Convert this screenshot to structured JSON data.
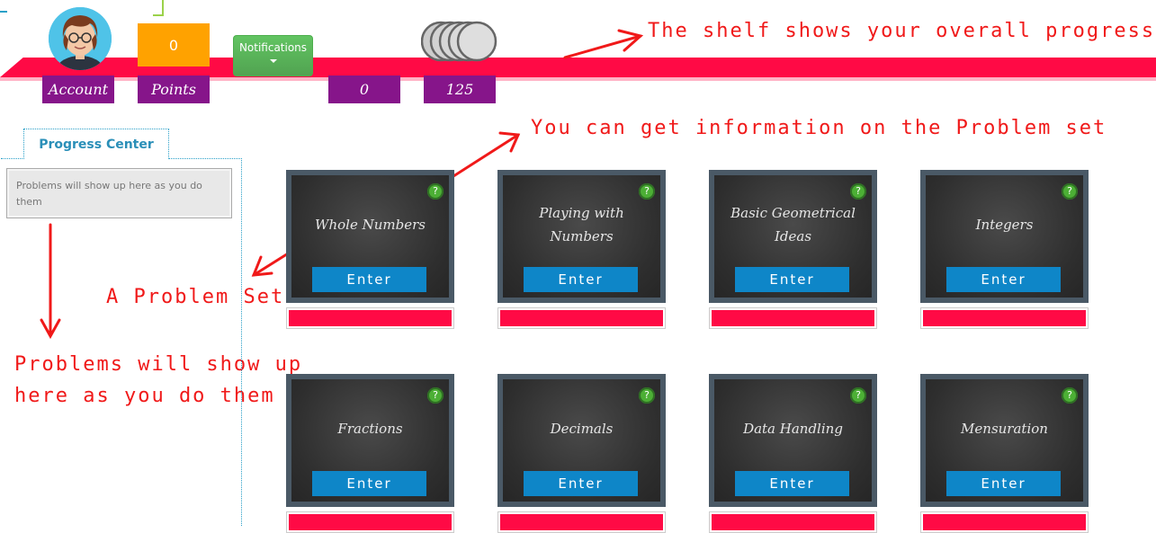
{
  "header": {
    "account_label": "Account",
    "points_label": "Points",
    "points_value": "0",
    "notifications_label": "Notifications",
    "shelf_count": "0",
    "coins_value": "125"
  },
  "annotations": {
    "shelf": "The shelf shows your overall progress",
    "info": "You can get information on the Problem set",
    "problem_set": "A Problem Set",
    "problems_line1": "Problems will show up",
    "problems_line2": "here as you do them"
  },
  "progress_center": {
    "tab_label": "Progress Center",
    "message": "Problems will show up here as you do them"
  },
  "problem_sets": [
    {
      "title": "Whole Numbers",
      "enter_label": "Enter",
      "info_icon": "?",
      "progress": 0
    },
    {
      "title": "Playing with Numbers",
      "enter_label": "Enter",
      "info_icon": "?",
      "progress": 0
    },
    {
      "title": "Basic Geometrical Ideas",
      "enter_label": "Enter",
      "info_icon": "?",
      "progress": 0
    },
    {
      "title": "Integers",
      "enter_label": "Enter",
      "info_icon": "?",
      "progress": 0
    },
    {
      "title": "Fractions",
      "enter_label": "Enter",
      "info_icon": "?",
      "progress": 0
    },
    {
      "title": "Decimals",
      "enter_label": "Enter",
      "info_icon": "?",
      "progress": 0
    },
    {
      "title": "Data Handling",
      "enter_label": "Enter",
      "info_icon": "?",
      "progress": 0
    },
    {
      "title": "Mensuration",
      "enter_label": "Enter",
      "info_icon": "?",
      "progress": 0
    }
  ],
  "colors": {
    "shelf": "#ff0a45",
    "tag": "#86158a",
    "points": "#ffa200",
    "enter": "#0e86c8",
    "annotation": "#f01919"
  }
}
